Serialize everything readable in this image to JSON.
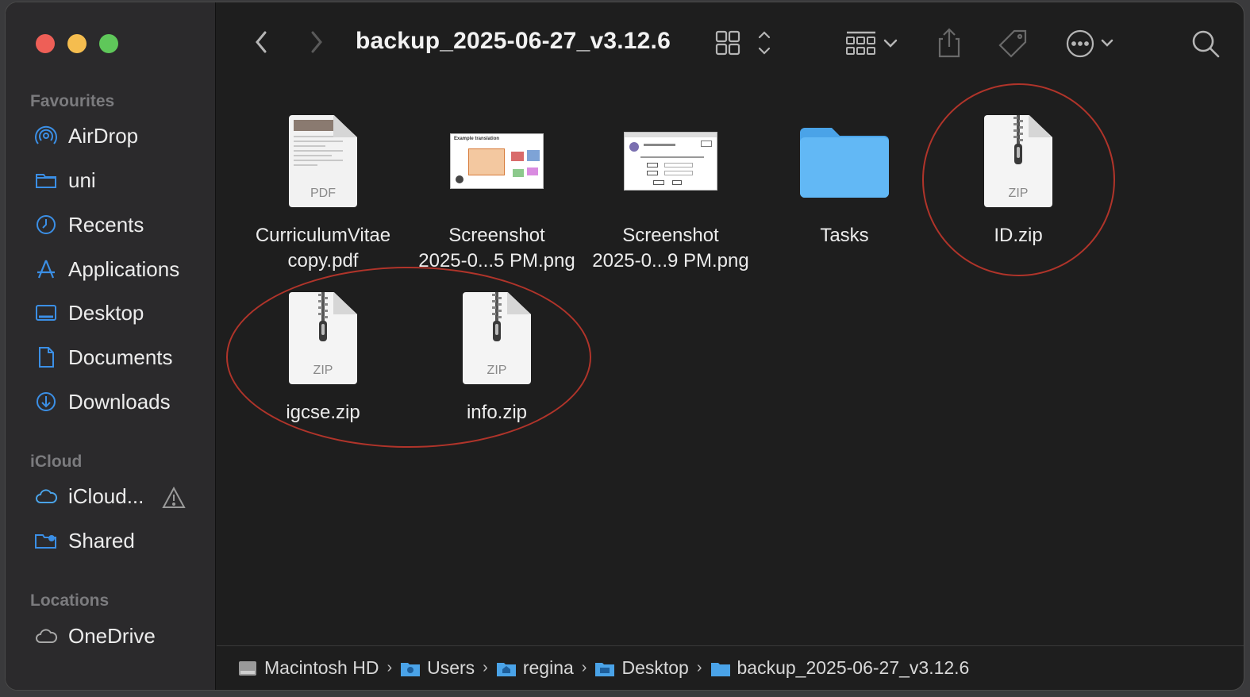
{
  "window": {
    "title": "backup_2025-06-27_v3.12.6"
  },
  "sidebar": {
    "sections": [
      {
        "label": "Favourites"
      },
      {
        "label": "iCloud"
      },
      {
        "label": "Locations"
      }
    ],
    "favourites": [
      {
        "label": "AirDrop",
        "icon": "airdrop-icon"
      },
      {
        "label": "uni",
        "icon": "folder-icon"
      },
      {
        "label": "Recents",
        "icon": "clock-icon"
      },
      {
        "label": "Applications",
        "icon": "applications-icon"
      },
      {
        "label": "Desktop",
        "icon": "desktop-icon"
      },
      {
        "label": "Documents",
        "icon": "document-icon"
      },
      {
        "label": "Downloads",
        "icon": "download-icon"
      }
    ],
    "icloud": [
      {
        "label": "iCloud...",
        "icon": "cloud-icon"
      },
      {
        "label": "Shared",
        "icon": "shared-folder-icon"
      }
    ],
    "locations": [
      {
        "label": "OneDrive",
        "icon": "cloud-icon"
      }
    ]
  },
  "files": [
    {
      "name_line1": "CurriculumVitae",
      "name_line2": "copy.pdf",
      "kind": "PDF"
    },
    {
      "name_line1": "Screenshot",
      "name_line2": "2025-0...5 PM.png",
      "kind": "png"
    },
    {
      "name_line1": "Screenshot",
      "name_line2": "2025-0...9 PM.png",
      "kind": "png"
    },
    {
      "name_line1": "Tasks",
      "name_line2": "",
      "kind": "folder"
    },
    {
      "name_line1": "ID.zip",
      "name_line2": "",
      "kind": "ZIP"
    },
    {
      "name_line1": "igcse.zip",
      "name_line2": "",
      "kind": "ZIP"
    },
    {
      "name_line1": "info.zip",
      "name_line2": "",
      "kind": "ZIP"
    }
  ],
  "thumb_text": {
    "shot1_title": "Example translation"
  },
  "pathbar": [
    {
      "label": "Macintosh HD"
    },
    {
      "label": "Users"
    },
    {
      "label": "regina"
    },
    {
      "label": "Desktop"
    },
    {
      "label": "backup_2025-06-27_v3.12.6"
    }
  ],
  "colors": {
    "accent": "#3b8fe6",
    "folder": "#5ab4f5",
    "annotation": "#b0342a"
  }
}
